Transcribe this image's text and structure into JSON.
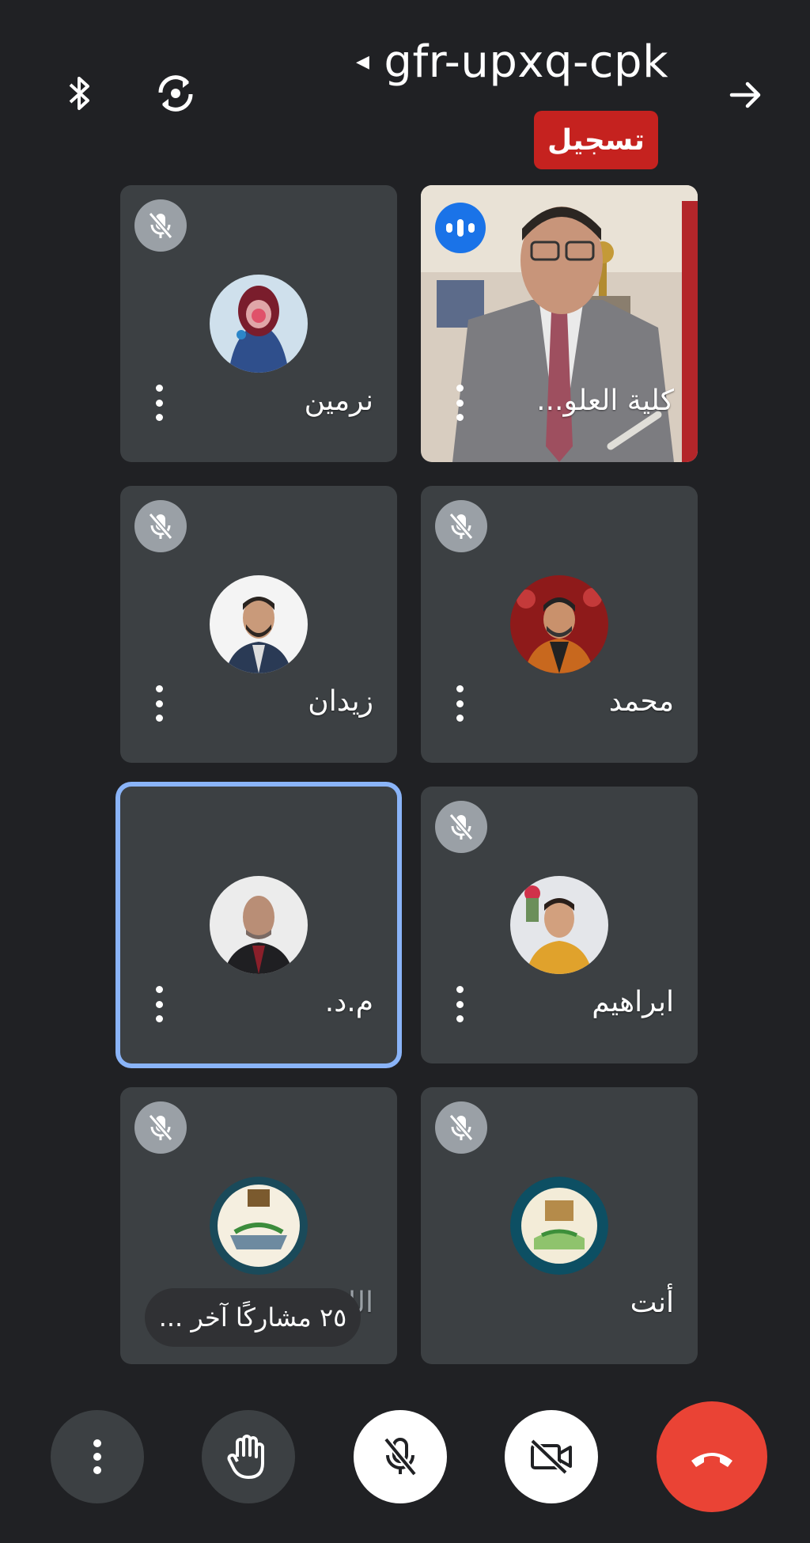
{
  "header": {
    "meeting_code": "gfr-upxq-cpk",
    "recording_label": "تسجيل",
    "icons": [
      "bluetooth-icon",
      "switch-camera-icon",
      "arrow-right-icon"
    ]
  },
  "participants": [
    {
      "name": "كلية العلو...",
      "muted": false,
      "speaking": true,
      "video_on": true
    },
    {
      "name": "نرمين",
      "muted": true,
      "speaking": false
    },
    {
      "name": "محمد",
      "muted": true
    },
    {
      "name": "زيدان",
      "muted": true
    },
    {
      "name": "ابراهيم",
      "muted": true
    },
    {
      "name": "م.د.",
      "muted": false,
      "pinned_highlight": true
    },
    {
      "name": "أنت",
      "muted": true
    },
    {
      "name": "الل..."
    }
  ],
  "others_pill": "٢٥ مشاركًا آخر ...",
  "controls": {
    "items": [
      "more-options",
      "raise-hand",
      "microphone-off",
      "camera-off",
      "leave-call"
    ],
    "colors": {
      "light_button": "#ffffff",
      "dark_button": "#3c4043",
      "end_call": "#ea4335"
    }
  },
  "colors": {
    "background": "#202124",
    "tile": "#3c4043",
    "recording": "#c5221f",
    "active_border": "#8ab4f8",
    "speaking": "#1a73e8"
  }
}
